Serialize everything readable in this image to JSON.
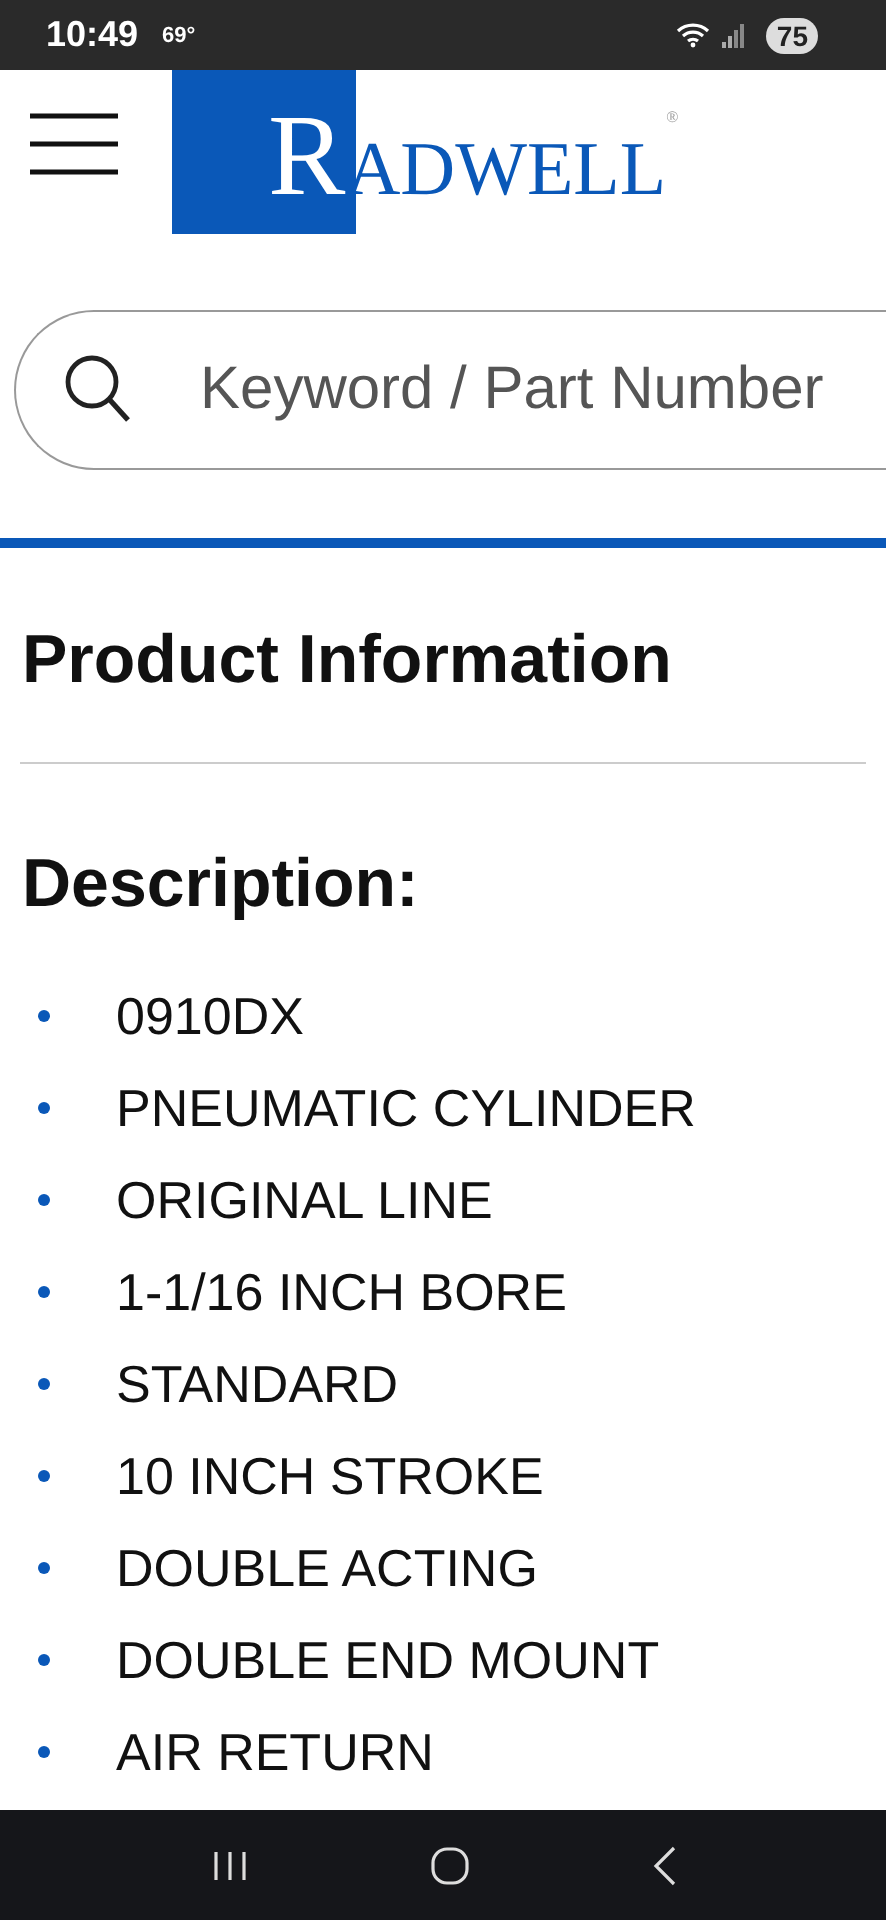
{
  "status_bar": {
    "time": "10:49",
    "temperature": "69°",
    "battery": "75"
  },
  "header": {
    "logo": "RADWELL",
    "logo_mark": "®"
  },
  "search": {
    "placeholder": "Keyword / Part Number"
  },
  "section_title": "Product Information",
  "description": {
    "heading": "Description:",
    "items": [
      "0910DX",
      "PNEUMATIC CYLINDER",
      "ORIGINAL LINE",
      "1-1/16 INCH BORE",
      "STANDARD",
      "10 INCH STROKE",
      "DOUBLE ACTING",
      "DOUBLE END MOUNT",
      "AIR RETURN"
    ]
  }
}
